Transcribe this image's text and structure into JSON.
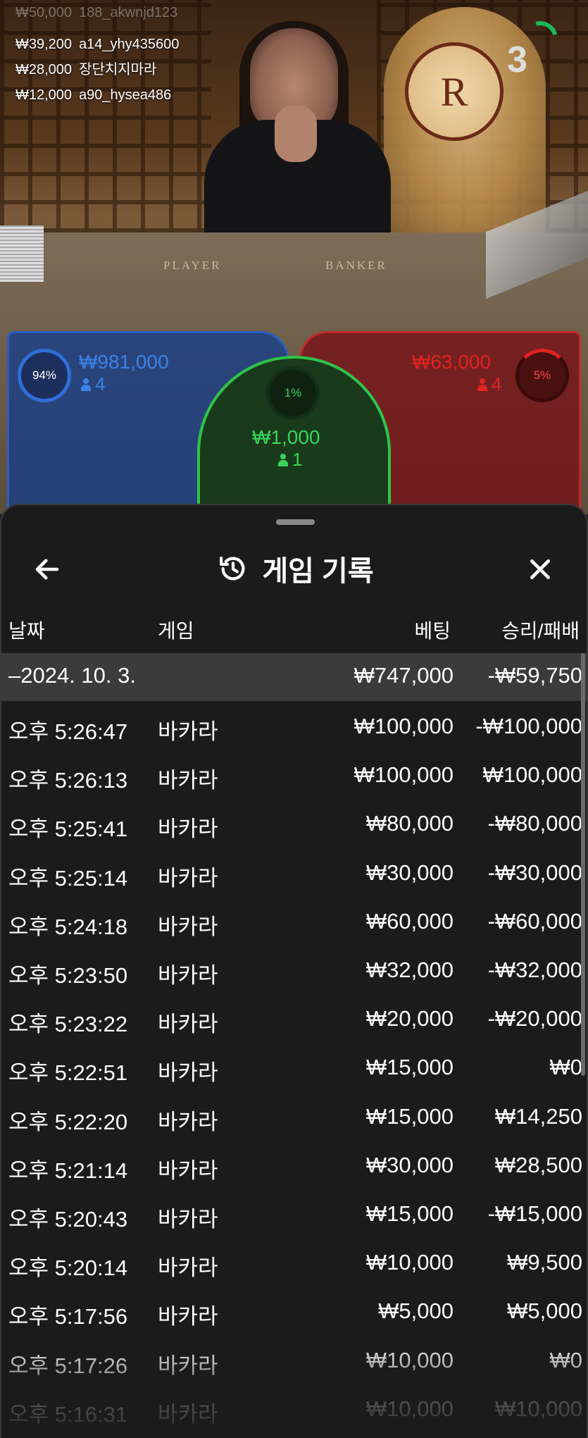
{
  "live": {
    "viewers": [
      {
        "amount": "₩39,200",
        "user": "a14_yhy435600"
      },
      {
        "amount": "₩28,000",
        "user": "장단치지마라"
      },
      {
        "amount": "₩12,000",
        "user": "a90_hysea486"
      }
    ],
    "viewer_faded": {
      "amount": "₩50,000",
      "user": "188_akwnjd123"
    },
    "countdown": "3",
    "felt_player": "PLAYER",
    "felt_banker": "BANKER",
    "logo_letter": "R"
  },
  "bets": {
    "player": {
      "percent": "94%",
      "amount": "₩981,000",
      "count": "4",
      "color": "#2f6fd8"
    },
    "banker": {
      "percent": "5%",
      "amount": "₩63,000",
      "count": "4",
      "color": "#e02222"
    },
    "tie": {
      "percent": "1%",
      "amount": "₩1,000",
      "count": "1",
      "color": "#38d45a"
    }
  },
  "history": {
    "title": "게임 기록",
    "back_icon": "arrow-left-icon",
    "history_icon": "history-clock-icon",
    "close_icon": "close-icon",
    "columns": {
      "date": "날짜",
      "game": "게임",
      "bet": "베팅",
      "result": "승리/패배"
    },
    "date_group": {
      "label": "–2024. 10. 3.",
      "bet": "₩747,000",
      "result": "-₩59,750"
    },
    "rows": [
      {
        "time": "오후 5:26:47",
        "game": "바카라",
        "bet": "₩100,000",
        "result": "-₩100,000"
      },
      {
        "time": "오후 5:26:13",
        "game": "바카라",
        "bet": "₩100,000",
        "result": "₩100,000"
      },
      {
        "time": "오후 5:25:41",
        "game": "바카라",
        "bet": "₩80,000",
        "result": "-₩80,000"
      },
      {
        "time": "오후 5:25:14",
        "game": "바카라",
        "bet": "₩30,000",
        "result": "-₩30,000"
      },
      {
        "time": "오후 5:24:18",
        "game": "바카라",
        "bet": "₩60,000",
        "result": "-₩60,000"
      },
      {
        "time": "오후 5:23:50",
        "game": "바카라",
        "bet": "₩32,000",
        "result": "-₩32,000"
      },
      {
        "time": "오후 5:23:22",
        "game": "바카라",
        "bet": "₩20,000",
        "result": "-₩20,000"
      },
      {
        "time": "오후 5:22:51",
        "game": "바카라",
        "bet": "₩15,000",
        "result": "₩0"
      },
      {
        "time": "오후 5:22:20",
        "game": "바카라",
        "bet": "₩15,000",
        "result": "₩14,250"
      },
      {
        "time": "오후 5:21:14",
        "game": "바카라",
        "bet": "₩30,000",
        "result": "₩28,500"
      },
      {
        "time": "오후 5:20:43",
        "game": "바카라",
        "bet": "₩15,000",
        "result": "-₩15,000"
      },
      {
        "time": "오후 5:20:14",
        "game": "바카라",
        "bet": "₩10,000",
        "result": "₩9,500"
      },
      {
        "time": "오후 5:17:56",
        "game": "바카라",
        "bet": "₩5,000",
        "result": "₩5,000"
      },
      {
        "time": "오후 5:17:26",
        "game": "바카라",
        "bet": "₩10,000",
        "result": "₩0"
      },
      {
        "time": "오후 5:16:31",
        "game": "바카라",
        "bet": "₩10,000",
        "result": "₩10,000"
      }
    ]
  }
}
